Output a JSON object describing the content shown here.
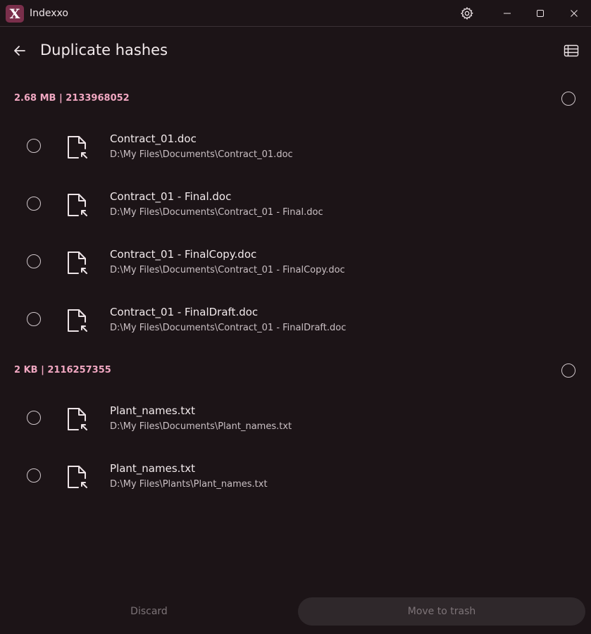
{
  "app": {
    "title": "Indexxo",
    "logo_letter": "X"
  },
  "icons": {
    "settings": "gear-icon",
    "minimize": "minimize-icon",
    "maximize": "maximize-icon",
    "close": "close-icon",
    "back": "arrow-left-icon",
    "view": "list-view-icon",
    "file": "file-shortcut-icon"
  },
  "page": {
    "title": "Duplicate hashes"
  },
  "groups": [
    {
      "header": "2.68 MB | 2133968052",
      "files": [
        {
          "name": "Contract_01.doc",
          "path": "D:\\My Files\\Documents\\Contract_01.doc"
        },
        {
          "name": "Contract_01 - Final.doc",
          "path": "D:\\My Files\\Documents\\Contract_01 - Final.doc"
        },
        {
          "name": "Contract_01 - FinalCopy.doc",
          "path": "D:\\My Files\\Documents\\Contract_01 - FinalCopy.doc"
        },
        {
          "name": "Contract_01 - FinalDraft.doc",
          "path": "D:\\My Files\\Documents\\Contract_01 - FinalDraft.doc"
        }
      ]
    },
    {
      "header": "2 KB | 2116257355",
      "files": [
        {
          "name": "Plant_names.txt",
          "path": "D:\\My Files\\Documents\\Plant_names.txt"
        },
        {
          "name": "Plant_names.txt",
          "path": "D:\\My Files\\Plants\\Plant_names.txt"
        }
      ]
    }
  ],
  "footer": {
    "discard_label": "Discard",
    "trash_label": "Move to trash"
  },
  "colors": {
    "background": "#1c1417",
    "accent": "#f0a7c1",
    "logo": "#7a2f4b",
    "disabled_button": "#2f282b"
  }
}
